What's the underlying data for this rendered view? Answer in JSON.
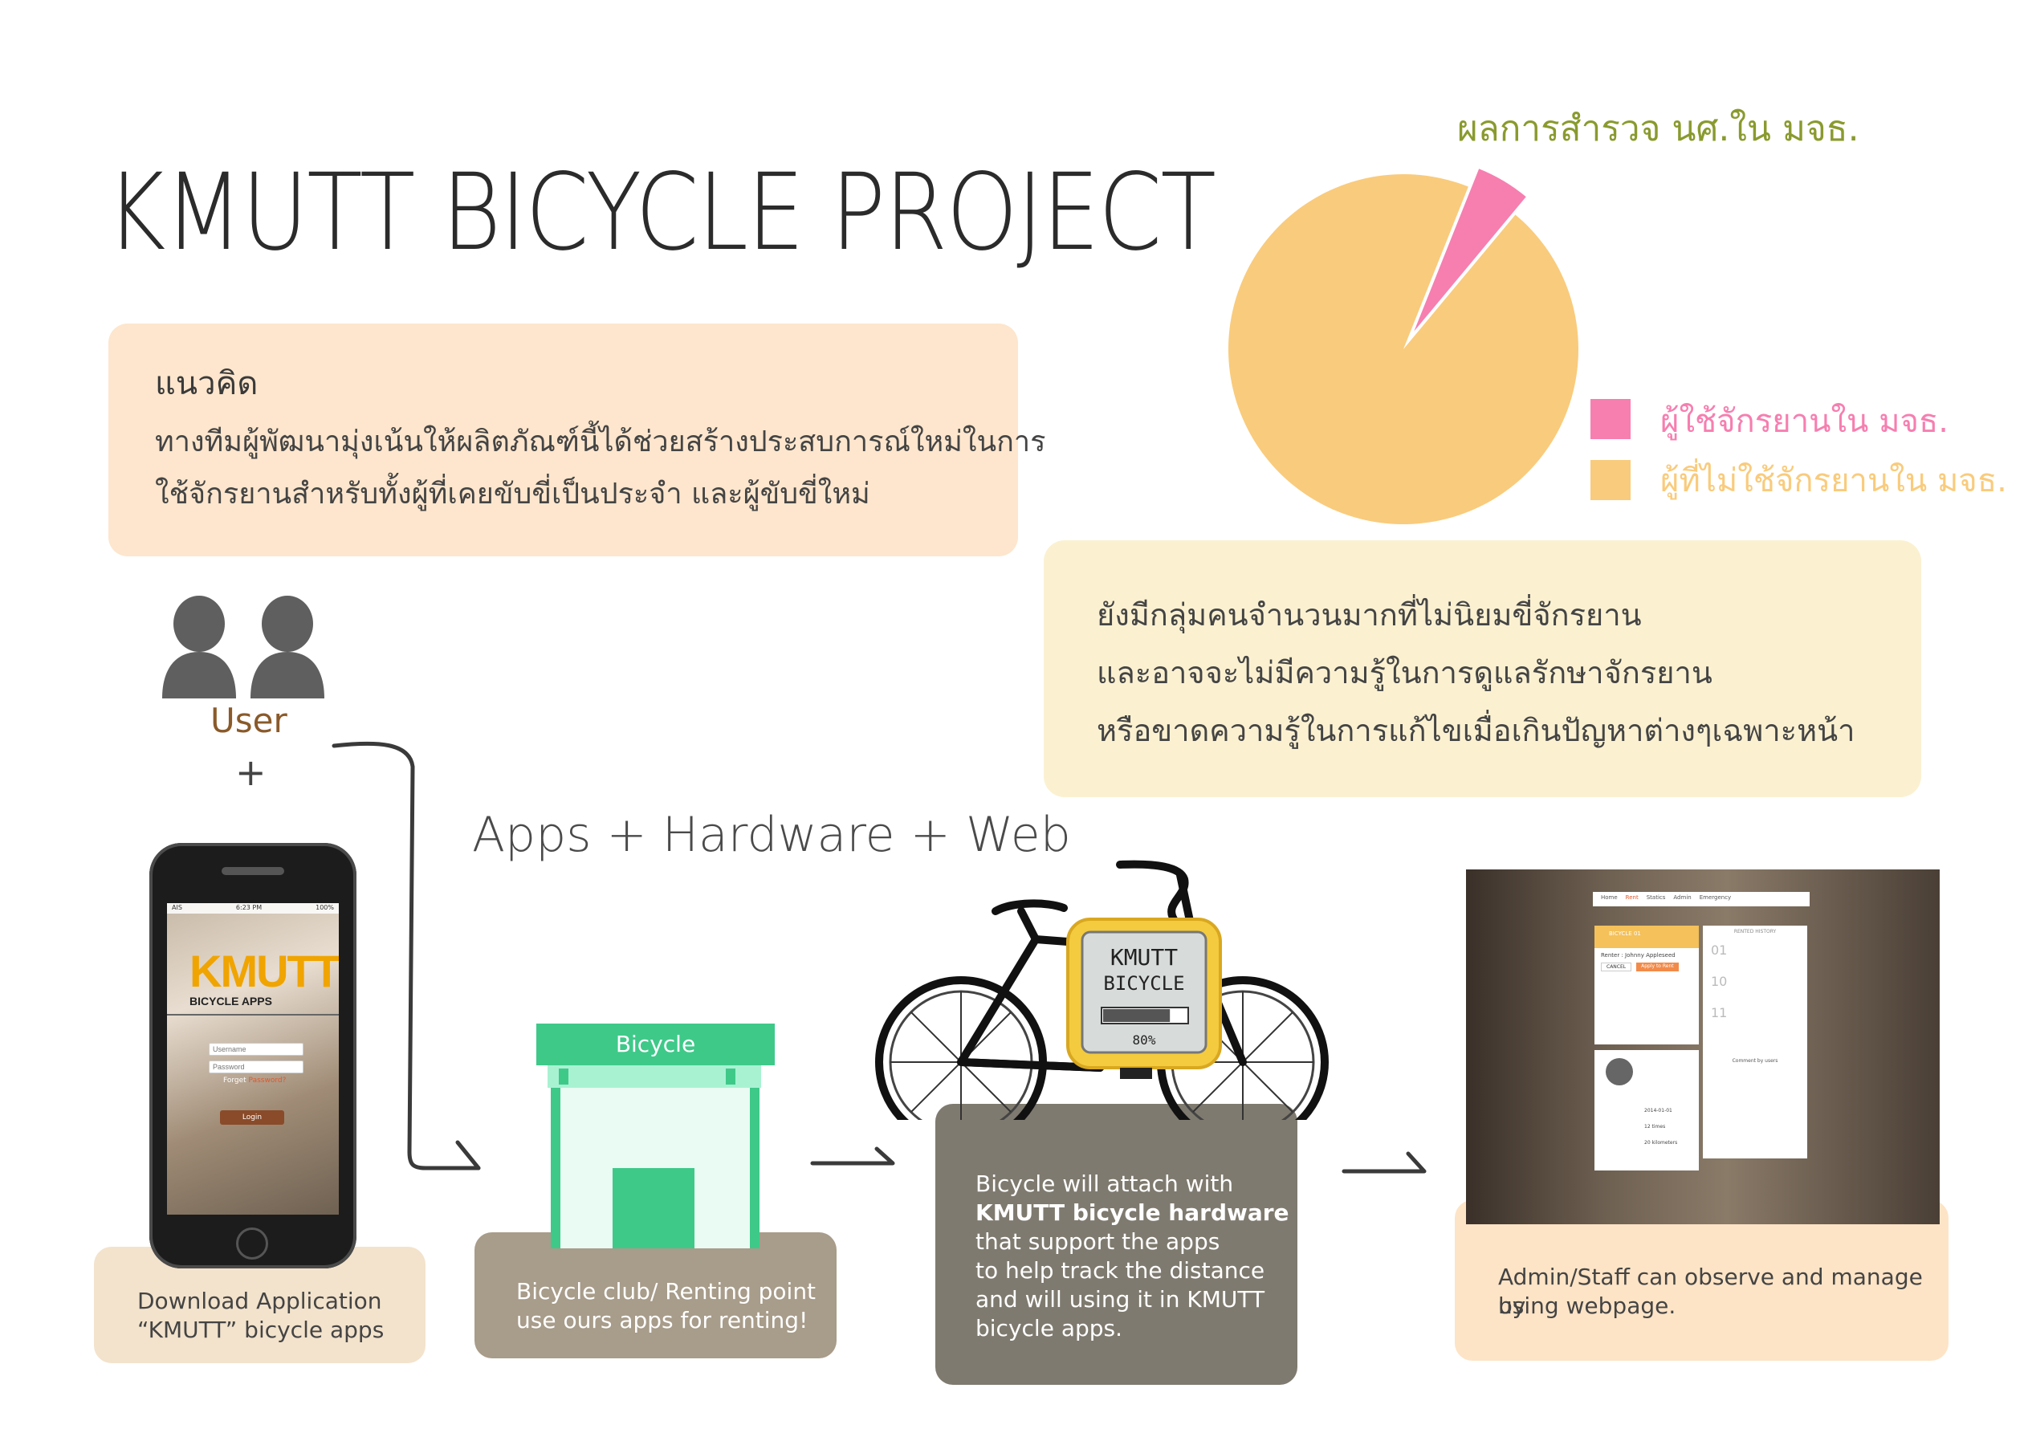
{
  "title": "KMUTT BICYCLE PROJECT",
  "concept": {
    "heading": "แนวคิด",
    "lines": [
      "ทางทีมผู้พัฒนามุ่งเน้นให้ผลิตภัณฑ์นี้ได้ช่วยสร้างประสบการณ์ใหม่ในการ",
      "ใช้จักรยานสำหรับทั้งผู้ที่เคยขับขี่เป็นประจำ และผู้ขับขี่ใหม่"
    ]
  },
  "survey": {
    "title": "ผลการสำรวจ นศ.ใน มจธ.",
    "legend": [
      {
        "label": "ผู้ใช้จักรยานใน มจธ.",
        "color": "#f67fb0"
      },
      {
        "label": "ผู้ที่ไม่ใช้จักรยานใน มจธ.",
        "color": "#f9cb7c"
      }
    ]
  },
  "chart_data": {
    "type": "pie",
    "title": "ผลการสำรวจ นศ.ใน มจธ.",
    "categories": [
      "ผู้ใช้จักรยานใน มจธ.",
      "ผู้ที่ไม่ใช้จักรยานใน มจธ."
    ],
    "values": [
      5,
      95
    ],
    "colors": [
      "#f67fb0",
      "#f9cb7c"
    ]
  },
  "problem": {
    "lines": [
      "ยังมีกลุ่มคนจำนวนมากที่ไม่นิยมขี่จักรยาน",
      "และอาจจะไม่มีความรู้ในการดูแลรักษาจักรยาน",
      "หรือขาดความรู้ในการแก้ไขเมื่อเกินปัญหาต่างๆเฉพาะหน้า"
    ]
  },
  "user_label": "User",
  "plus": "+",
  "flow_title": "Apps + Hardware + Web",
  "phone": {
    "carrier": "AIS",
    "time": "6:23 PM",
    "battery": "100%",
    "logo": "KMUTT",
    "subtitle": "BICYCLE APPS",
    "username_placeholder": "Username",
    "password_placeholder": "Password",
    "forget_prefix": "Forget ",
    "forget_link": "Password?",
    "login": "Login",
    "caption_lines": [
      "Download Application",
      "“KMUTT” bicycle apps"
    ]
  },
  "shop": {
    "sign": "Bicycle",
    "caption_lines": [
      "Bicycle club/ Renting point",
      "use ours apps for renting!"
    ]
  },
  "bike": {
    "device_line1": "KMUTT",
    "device_line2": "BICYCLE",
    "progress_label": "80%",
    "progress_value": 0.8,
    "caption_lines": [
      {
        "text": "Bicycle will attach with",
        "bold": false
      },
      {
        "text": "KMUTT bicycle hardware",
        "bold": true
      },
      {
        "text": "that support the apps",
        "bold": false
      },
      {
        "text": "to help track the distance",
        "bold": false
      },
      {
        "text": "and will using it in KMUTT",
        "bold": false
      },
      {
        "text": "bicycle apps.",
        "bold": false
      }
    ]
  },
  "web": {
    "nav": [
      "Home",
      "Rent",
      "Statics",
      "Admin",
      "Emergency"
    ],
    "card_title": "BICYCLE 01",
    "renter_label": "Renter :",
    "renter_name": "Johnny Appleseed",
    "cancel": "CANCEL",
    "apply": "Apply to Rent",
    "history_title": "RENTED HISTORY",
    "history_days": [
      "01",
      "10",
      "11"
    ],
    "comment_title": "Comment by users",
    "detail_date": "2014-01-01",
    "detail_times": "12 times",
    "detail_km": "20 kilometers",
    "caption_lines": [
      "Admin/Staff can observe and manage by",
      "using webpage."
    ]
  }
}
